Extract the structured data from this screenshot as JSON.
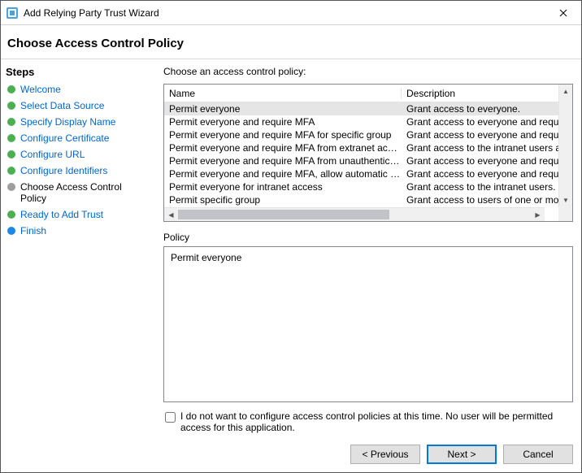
{
  "window": {
    "title": "Add Relying Party Trust Wizard"
  },
  "header": "Choose Access Control Policy",
  "sidebar": {
    "title": "Steps",
    "items": [
      {
        "label": "Welcome",
        "state": "done",
        "link": true
      },
      {
        "label": "Select Data Source",
        "state": "done",
        "link": true
      },
      {
        "label": "Specify Display Name",
        "state": "done",
        "link": true
      },
      {
        "label": "Configure Certificate",
        "state": "done",
        "link": true
      },
      {
        "label": "Configure URL",
        "state": "done",
        "link": true
      },
      {
        "label": "Configure Identifiers",
        "state": "done",
        "link": true
      },
      {
        "label": "Choose Access Control Policy",
        "state": "current",
        "link": false
      },
      {
        "label": "Ready to Add Trust",
        "state": "future",
        "link": true
      },
      {
        "label": "Finish",
        "state": "final",
        "link": true
      }
    ]
  },
  "main": {
    "instruction": "Choose an access control policy:",
    "columns": {
      "name": "Name",
      "description": "Description"
    },
    "policies": [
      {
        "name": "Permit everyone",
        "desc": "Grant access to everyone.",
        "selected": true
      },
      {
        "name": "Permit everyone and require MFA",
        "desc": "Grant access to everyone and requir"
      },
      {
        "name": "Permit everyone and require MFA for specific group",
        "desc": "Grant access to everyone and requir"
      },
      {
        "name": "Permit everyone and require MFA from extranet access",
        "desc": "Grant access to the intranet users ar"
      },
      {
        "name": "Permit everyone and require MFA from unauthenticated devices",
        "desc": "Grant access to everyone and requir"
      },
      {
        "name": "Permit everyone and require MFA, allow automatic device registr...",
        "desc": "Grant access to everyone and requir"
      },
      {
        "name": "Permit everyone for intranet access",
        "desc": "Grant access to the intranet users."
      },
      {
        "name": "Permit specific group",
        "desc": "Grant access to users of one or more"
      }
    ],
    "policy_label": "Policy",
    "policy_text": "Permit everyone",
    "skip_checkbox_label": "I do not want to configure access control policies at this time. No user will be permitted access for this application.",
    "skip_checked": false
  },
  "buttons": {
    "previous": "< Previous",
    "next": "Next >",
    "cancel": "Cancel"
  }
}
